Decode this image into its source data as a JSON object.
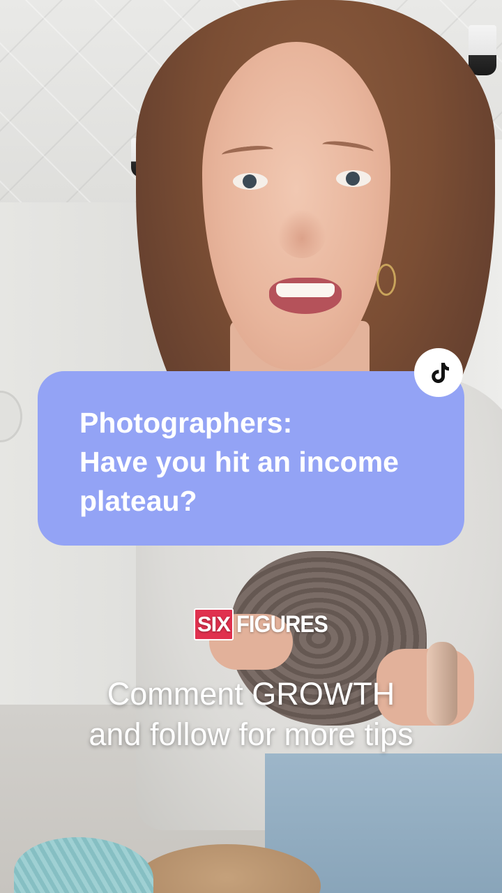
{
  "overlay": {
    "caption": "Photographers:\nHave you hit an income plateau?",
    "cta": "Comment GROWTH\nand follow for more tips",
    "brand": {
      "boxed_word": "SIX",
      "word": "FIGURES"
    },
    "platform_icon": "tiktok-icon",
    "colors": {
      "caption_card": "#93a3f5",
      "brand_box": "#e0314e",
      "text": "#ffffff"
    }
  }
}
